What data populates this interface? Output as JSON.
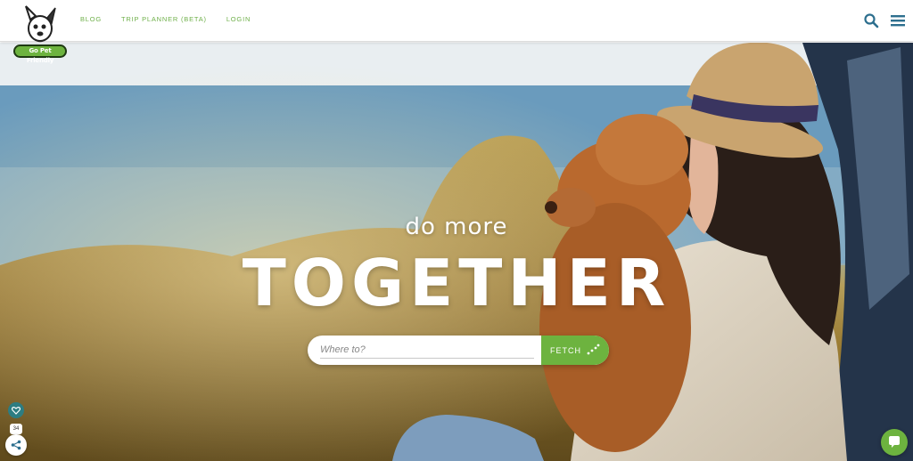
{
  "header": {
    "logo_text": "Go Pet Friendly",
    "nav": [
      {
        "label": "BLOG"
      },
      {
        "label": "TRIP PLANNER (BETA)"
      },
      {
        "label": "LOGIN"
      }
    ],
    "icons": {
      "search": "search-icon",
      "menu": "hamburger-menu-icon"
    }
  },
  "hero": {
    "tagline_small": "do more",
    "tagline_big": "TOGETHER"
  },
  "search": {
    "placeholder": "Where to?",
    "value": "",
    "button_label": "FETCH"
  },
  "widgets": {
    "share_count": "34"
  },
  "colors": {
    "brand_green": "#6db33f",
    "nav_text": "#6fb04a",
    "icon_teal": "#2d6f8e",
    "white": "#ffffff"
  }
}
